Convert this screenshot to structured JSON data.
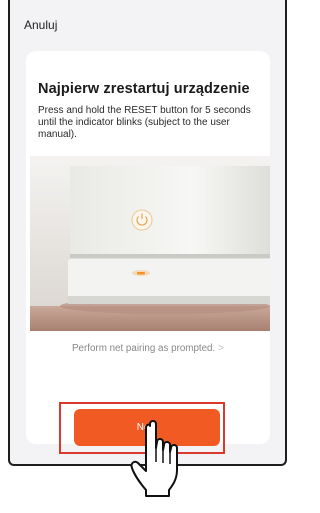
{
  "header": {
    "cancel_label": "Anuluj"
  },
  "card": {
    "title": "Najpierw zrestartuj urządzenie",
    "description": "Press and hold the RESET button for 5 seconds until the indicator blinks (subject to the user manual).",
    "hint": "Perform net pairing as prompted.",
    "hint_chevron": ">"
  },
  "actions": {
    "next_label": "Next"
  },
  "colors": {
    "accent": "#f25a24",
    "highlight": "#d93a2b",
    "indicator": "#f28c1e"
  },
  "icons": [
    "power-icon",
    "chevron-right-icon",
    "pointer-hand-icon"
  ]
}
